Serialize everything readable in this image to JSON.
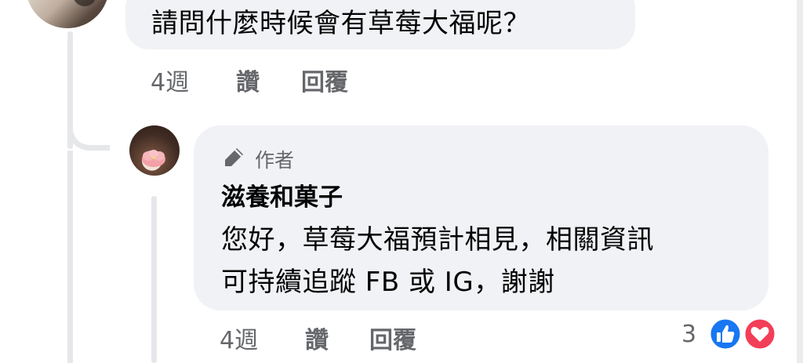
{
  "top_comment": {
    "text": "請問什麼時候會有草莓大福呢？",
    "time": "4週",
    "like_label": "讚",
    "reply_label": "回覆"
  },
  "author_reply": {
    "badge": "作者",
    "name": "滋養和菓子",
    "lines": [
      "您好，草莓大福預計相見，相關資訊",
      "可持續追蹤 FB 或 IG，謝謝"
    ],
    "time": "4週",
    "like_label": "讚",
    "reply_label": "回覆",
    "reaction_count": "3",
    "reaction_icons": [
      "like-icon",
      "love-icon"
    ]
  },
  "colors": {
    "bubble": "#f0f2f5",
    "text": "#050505",
    "meta": "#65676b",
    "like_blue": "#1877f2",
    "love_red": "#f33e58"
  }
}
